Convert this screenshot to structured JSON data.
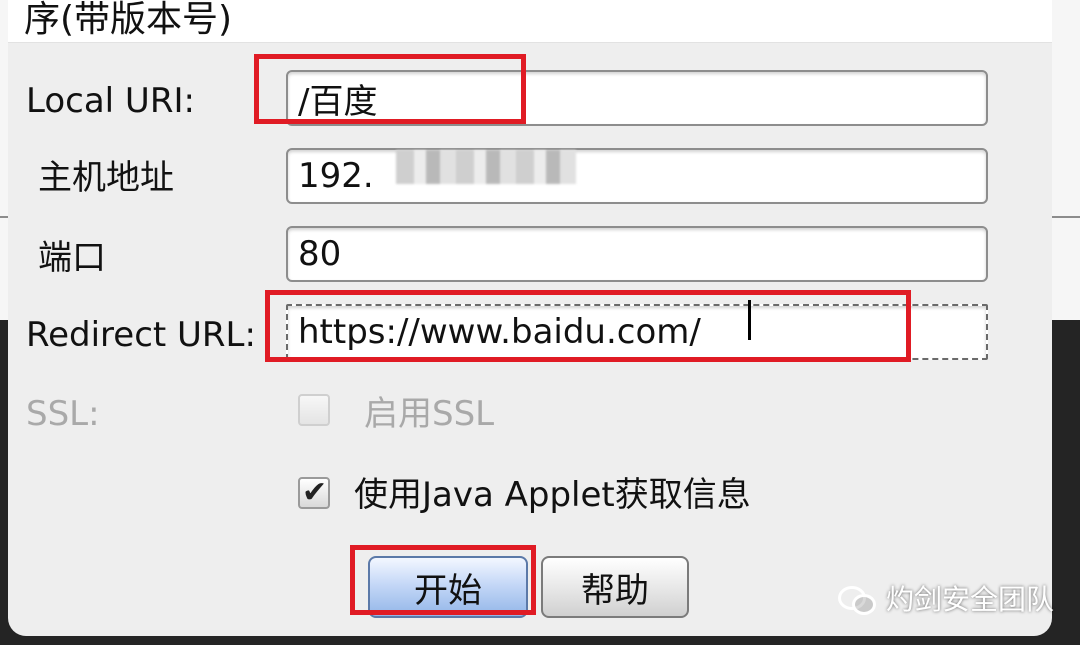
{
  "dialog": {
    "title": "序(带版本号)"
  },
  "form": {
    "local_uri": {
      "label": "Local URI:",
      "value": "/百度"
    },
    "host": {
      "label": "主机地址",
      "value": "192."
    },
    "port": {
      "label": "端口",
      "value": "80"
    },
    "redirect_url": {
      "label": "Redirect URL:",
      "value": "https://www.baidu.com/"
    },
    "ssl": {
      "label": "SSL:",
      "checkbox_label": "启用SSL",
      "checked": false,
      "disabled": true
    },
    "java_applet": {
      "checkbox_label": "使用Java Applet获取信息",
      "checked": true
    }
  },
  "buttons": {
    "start": "开始",
    "help": "帮助"
  },
  "watermark": {
    "text": "灼剑安全团队",
    "icon": "wechat-icon"
  },
  "colors": {
    "annotation": "#e01b24",
    "primary_button": "#93b6e8"
  }
}
